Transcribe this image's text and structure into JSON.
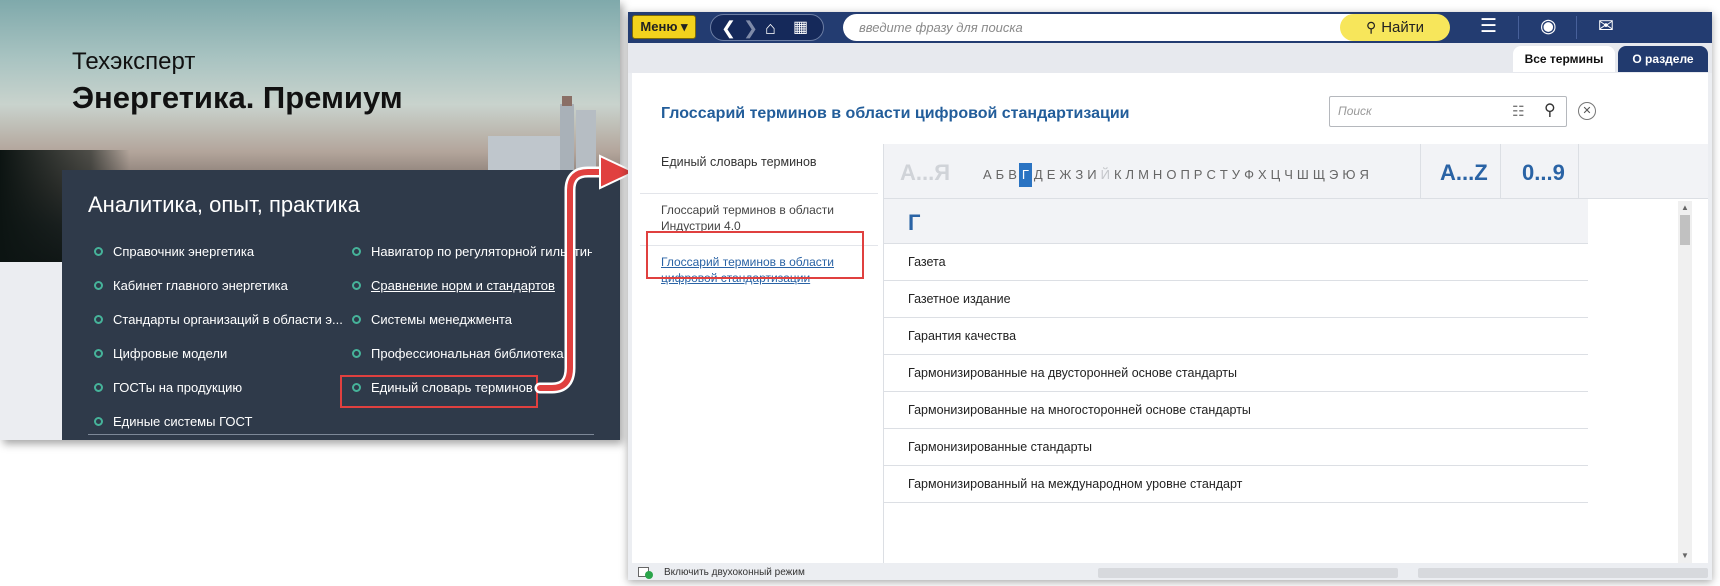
{
  "left_panel": {
    "brand_line1": "Техэксперт",
    "brand_line2": "Энергетика. Премиум",
    "section_title": "Аналитика, опыт, практика",
    "col1": [
      "Справочник энергетика",
      "Кабинет главного энергетика",
      "Стандарты организаций в области э...",
      "Цифровые модели",
      "ГОСТы на продукцию",
      "Единые системы ГОСТ"
    ],
    "col2": [
      "Навигатор по регуляторной гильотине",
      "Сравнение норм и стандартов",
      "Системы менеджмента",
      "Профессиональная библиотека",
      "Единый словарь терминов"
    ]
  },
  "toolbar": {
    "menu_label": "Меню ▾",
    "search_placeholder": "введите фразу для поиска",
    "find_label": "Найти"
  },
  "tabs": {
    "all_terms": "Все термины",
    "about": "О разделе"
  },
  "glossary": {
    "title": "Глоссарий терминов в области цифровой стандартизации",
    "search_placeholder": "Поиск",
    "list": [
      "Единый словарь терминов",
      "Глоссарий терминов в области Индустрии 4.0",
      "Глоссарий терминов в области цифровой стандартизации"
    ],
    "alpha_ru_label": "А...Я",
    "letters": [
      "А",
      "Б",
      "В",
      "Г",
      "Д",
      "Е",
      "Ж",
      "З",
      "И",
      "Й",
      "К",
      "Л",
      "М",
      "Н",
      "О",
      "П",
      "Р",
      "С",
      "Т",
      "У",
      "Ф",
      "Х",
      "Ц",
      "Ч",
      "Ш",
      "Щ",
      "Э",
      "Ю",
      "Я"
    ],
    "alpha_en_label": "A...Z",
    "alpha_num_label": "0...9",
    "current_letter": "Г",
    "terms": [
      "Газета",
      "Газетное издание",
      "Гарантия качества",
      "Гармонизированные на двусторонней основе стандарты",
      "Гармонизированные на многосторонней основе стандарты",
      "Гармонизированные стандарты",
      "Гармонизированный на международном уровне стандарт"
    ]
  },
  "statusbar": {
    "dual_mode": "Включить двухоконный режим"
  },
  "colors": {
    "highlight_red": "#e0403f",
    "panel_navy": "#2f3a4a",
    "topbar_blue": "#233c71",
    "accent_blue": "#2a63a5",
    "menu_yellow": "#f2d21d",
    "bullet_green": "#46b39a"
  }
}
